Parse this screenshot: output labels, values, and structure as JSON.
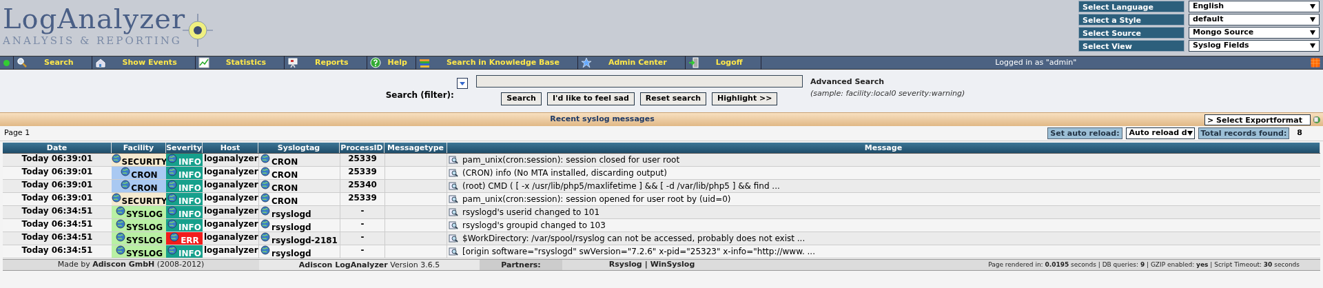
{
  "logo": {
    "title": "LogAnalyzer",
    "subtitle": "ANALYSIS & REPORTING"
  },
  "selectors": [
    {
      "label": "Select Language",
      "value": "English"
    },
    {
      "label": "Select a Style",
      "value": "default"
    },
    {
      "label": "Select Source",
      "value": "Mongo Source"
    },
    {
      "label": "Select View",
      "value": "Syslog Fields"
    }
  ],
  "nav": [
    {
      "label": "Search",
      "kind": "search"
    },
    {
      "label": "Show Events",
      "kind": "home"
    },
    {
      "label": "Statistics",
      "kind": "chart"
    },
    {
      "label": "Reports",
      "kind": "report"
    },
    {
      "label": "Help",
      "kind": "help"
    },
    {
      "label": "Search in Knowledge Base",
      "kind": "books"
    },
    {
      "label": "Admin Center",
      "kind": "star"
    },
    {
      "label": "Logoff",
      "kind": "door"
    }
  ],
  "login_status": "Logged in as \"admin\"",
  "search": {
    "label": "Search (filter):",
    "advanced_title": "Advanced Search",
    "advanced_hint": "(sample: facility:local0 severity:warning)",
    "buttons": [
      "Search",
      "I'd like to feel sad",
      "Reset search",
      "Highlight >>"
    ]
  },
  "section_title": "Recent syslog messages",
  "export_select": "> Select Exportformat",
  "page_label": "Page 1",
  "auto_reload": {
    "label": "Set auto reload:",
    "value": "Auto reload d"
  },
  "total": {
    "label": "Total records found:",
    "value": "8"
  },
  "table": {
    "columns": [
      "Date",
      "Facility",
      "Severity",
      "Host",
      "Syslogtag",
      "ProcessID",
      "Messagetype",
      "Message"
    ],
    "rows": [
      {
        "date": "Today 06:39:01",
        "facility": {
          "label": "SECURITY",
          "color": "#f5ead0"
        },
        "severity": {
          "label": "INFO",
          "color": "#16a08c"
        },
        "host": "loganalyzer",
        "tag": "CRON",
        "pid": "25339",
        "message": "pam_unix(cron:session): session closed for user root"
      },
      {
        "date": "Today 06:39:01",
        "facility": {
          "label": "CRON",
          "color": "#a9c9f2"
        },
        "severity": {
          "label": "INFO",
          "color": "#16a08c"
        },
        "host": "loganalyzer",
        "tag": "CRON",
        "pid": "25339",
        "message": "(CRON) info (No MTA installed, discarding output)"
      },
      {
        "date": "Today 06:39:01",
        "facility": {
          "label": "CRON",
          "color": "#a9c9f2"
        },
        "severity": {
          "label": "INFO",
          "color": "#16a08c"
        },
        "host": "loganalyzer",
        "tag": "CRON",
        "pid": "25340",
        "message": "(root) CMD ( [ -x /usr/lib/php5/maxlifetime ] && [ -d /var/lib/php5 ] && find ..."
      },
      {
        "date": "Today 06:39:01",
        "facility": {
          "label": "SECURITY",
          "color": "#f5ead0"
        },
        "severity": {
          "label": "INFO",
          "color": "#16a08c"
        },
        "host": "loganalyzer",
        "tag": "CRON",
        "pid": "25339",
        "message": "pam_unix(cron:session): session opened for user root by (uid=0)"
      },
      {
        "date": "Today 06:34:51",
        "facility": {
          "label": "SYSLOG",
          "color": "#b9f0a4"
        },
        "severity": {
          "label": "INFO",
          "color": "#16a08c"
        },
        "host": "loganalyzer",
        "tag": "rsyslogd",
        "pid": "-",
        "message": "rsyslogd's userid changed to 101"
      },
      {
        "date": "Today 06:34:51",
        "facility": {
          "label": "SYSLOG",
          "color": "#b9f0a4"
        },
        "severity": {
          "label": "INFO",
          "color": "#16a08c"
        },
        "host": "loganalyzer",
        "tag": "rsyslogd",
        "pid": "-",
        "message": "rsyslogd's groupid changed to 103"
      },
      {
        "date": "Today 06:34:51",
        "facility": {
          "label": "SYSLOG",
          "color": "#b9f0a4"
        },
        "severity": {
          "label": "ERR",
          "color": "#f21c1c"
        },
        "host": "loganalyzer",
        "tag": "rsyslogd-2181",
        "pid": "-",
        "message": "$WorkDirectory: /var/spool/rsyslog can not be accessed, probably does not exist ..."
      },
      {
        "date": "Today 06:34:51",
        "facility": {
          "label": "SYSLOG",
          "color": "#b9f0a4"
        },
        "severity": {
          "label": "INFO",
          "color": "#16a08c"
        },
        "host": "loganalyzer",
        "tag": "rsyslogd",
        "pid": "-",
        "message": "[origin software=\"rsyslogd\" swVersion=\"7.2.6\" x-pid=\"25323\" x-info=\"http://www. ..."
      }
    ]
  },
  "footer": {
    "made_by": "Made by **Adiscon GmbH** (2008-2012)",
    "version": "**Adiscon LogAnalyzer** Version 3.6.5",
    "partners_label": "Partners:",
    "partners": [
      "Rsyslog",
      "WinSyslog"
    ],
    "separator": "|",
    "stats": "Page rendered in: **0.0195** seconds | DB queries: **9** | GZIP enabled: **yes** | Script Timeout: **30** seconds"
  }
}
